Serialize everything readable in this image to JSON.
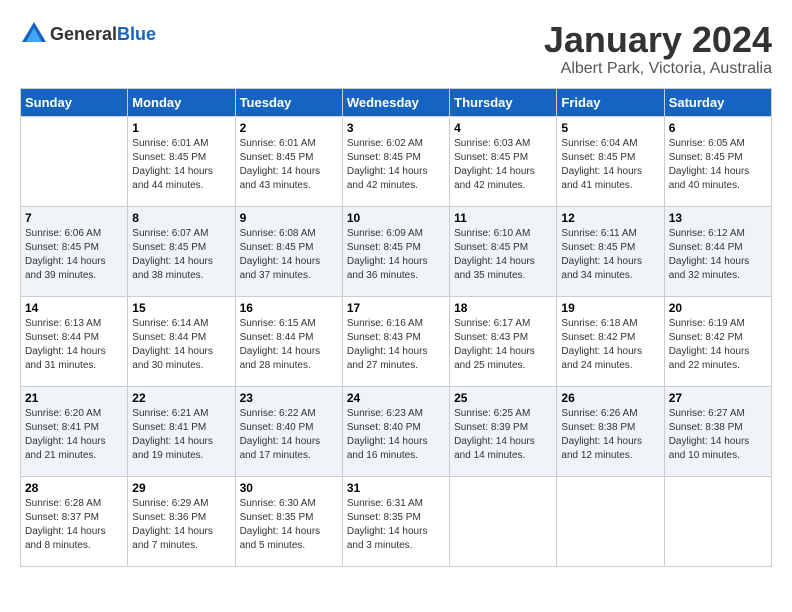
{
  "logo": {
    "text_general": "General",
    "text_blue": "Blue"
  },
  "header": {
    "month_year": "January 2024",
    "location": "Albert Park, Victoria, Australia"
  },
  "columns": [
    "Sunday",
    "Monday",
    "Tuesday",
    "Wednesday",
    "Thursday",
    "Friday",
    "Saturday"
  ],
  "rows": [
    [
      {
        "date": "",
        "sunrise": "",
        "sunset": "",
        "daylight": ""
      },
      {
        "date": "1",
        "sunrise": "Sunrise: 6:01 AM",
        "sunset": "Sunset: 8:45 PM",
        "daylight": "Daylight: 14 hours and 44 minutes."
      },
      {
        "date": "2",
        "sunrise": "Sunrise: 6:01 AM",
        "sunset": "Sunset: 8:45 PM",
        "daylight": "Daylight: 14 hours and 43 minutes."
      },
      {
        "date": "3",
        "sunrise": "Sunrise: 6:02 AM",
        "sunset": "Sunset: 8:45 PM",
        "daylight": "Daylight: 14 hours and 42 minutes."
      },
      {
        "date": "4",
        "sunrise": "Sunrise: 6:03 AM",
        "sunset": "Sunset: 8:45 PM",
        "daylight": "Daylight: 14 hours and 42 minutes."
      },
      {
        "date": "5",
        "sunrise": "Sunrise: 6:04 AM",
        "sunset": "Sunset: 8:45 PM",
        "daylight": "Daylight: 14 hours and 41 minutes."
      },
      {
        "date": "6",
        "sunrise": "Sunrise: 6:05 AM",
        "sunset": "Sunset: 8:45 PM",
        "daylight": "Daylight: 14 hours and 40 minutes."
      }
    ],
    [
      {
        "date": "7",
        "sunrise": "Sunrise: 6:06 AM",
        "sunset": "Sunset: 8:45 PM",
        "daylight": "Daylight: 14 hours and 39 minutes."
      },
      {
        "date": "8",
        "sunrise": "Sunrise: 6:07 AM",
        "sunset": "Sunset: 8:45 PM",
        "daylight": "Daylight: 14 hours and 38 minutes."
      },
      {
        "date": "9",
        "sunrise": "Sunrise: 6:08 AM",
        "sunset": "Sunset: 8:45 PM",
        "daylight": "Daylight: 14 hours and 37 minutes."
      },
      {
        "date": "10",
        "sunrise": "Sunrise: 6:09 AM",
        "sunset": "Sunset: 8:45 PM",
        "daylight": "Daylight: 14 hours and 36 minutes."
      },
      {
        "date": "11",
        "sunrise": "Sunrise: 6:10 AM",
        "sunset": "Sunset: 8:45 PM",
        "daylight": "Daylight: 14 hours and 35 minutes."
      },
      {
        "date": "12",
        "sunrise": "Sunrise: 6:11 AM",
        "sunset": "Sunset: 8:45 PM",
        "daylight": "Daylight: 14 hours and 34 minutes."
      },
      {
        "date": "13",
        "sunrise": "Sunrise: 6:12 AM",
        "sunset": "Sunset: 8:44 PM",
        "daylight": "Daylight: 14 hours and 32 minutes."
      }
    ],
    [
      {
        "date": "14",
        "sunrise": "Sunrise: 6:13 AM",
        "sunset": "Sunset: 8:44 PM",
        "daylight": "Daylight: 14 hours and 31 minutes."
      },
      {
        "date": "15",
        "sunrise": "Sunrise: 6:14 AM",
        "sunset": "Sunset: 8:44 PM",
        "daylight": "Daylight: 14 hours and 30 minutes."
      },
      {
        "date": "16",
        "sunrise": "Sunrise: 6:15 AM",
        "sunset": "Sunset: 8:44 PM",
        "daylight": "Daylight: 14 hours and 28 minutes."
      },
      {
        "date": "17",
        "sunrise": "Sunrise: 6:16 AM",
        "sunset": "Sunset: 8:43 PM",
        "daylight": "Daylight: 14 hours and 27 minutes."
      },
      {
        "date": "18",
        "sunrise": "Sunrise: 6:17 AM",
        "sunset": "Sunset: 8:43 PM",
        "daylight": "Daylight: 14 hours and 25 minutes."
      },
      {
        "date": "19",
        "sunrise": "Sunrise: 6:18 AM",
        "sunset": "Sunset: 8:42 PM",
        "daylight": "Daylight: 14 hours and 24 minutes."
      },
      {
        "date": "20",
        "sunrise": "Sunrise: 6:19 AM",
        "sunset": "Sunset: 8:42 PM",
        "daylight": "Daylight: 14 hours and 22 minutes."
      }
    ],
    [
      {
        "date": "21",
        "sunrise": "Sunrise: 6:20 AM",
        "sunset": "Sunset: 8:41 PM",
        "daylight": "Daylight: 14 hours and 21 minutes."
      },
      {
        "date": "22",
        "sunrise": "Sunrise: 6:21 AM",
        "sunset": "Sunset: 8:41 PM",
        "daylight": "Daylight: 14 hours and 19 minutes."
      },
      {
        "date": "23",
        "sunrise": "Sunrise: 6:22 AM",
        "sunset": "Sunset: 8:40 PM",
        "daylight": "Daylight: 14 hours and 17 minutes."
      },
      {
        "date": "24",
        "sunrise": "Sunrise: 6:23 AM",
        "sunset": "Sunset: 8:40 PM",
        "daylight": "Daylight: 14 hours and 16 minutes."
      },
      {
        "date": "25",
        "sunrise": "Sunrise: 6:25 AM",
        "sunset": "Sunset: 8:39 PM",
        "daylight": "Daylight: 14 hours and 14 minutes."
      },
      {
        "date": "26",
        "sunrise": "Sunrise: 6:26 AM",
        "sunset": "Sunset: 8:38 PM",
        "daylight": "Daylight: 14 hours and 12 minutes."
      },
      {
        "date": "27",
        "sunrise": "Sunrise: 6:27 AM",
        "sunset": "Sunset: 8:38 PM",
        "daylight": "Daylight: 14 hours and 10 minutes."
      }
    ],
    [
      {
        "date": "28",
        "sunrise": "Sunrise: 6:28 AM",
        "sunset": "Sunset: 8:37 PM",
        "daylight": "Daylight: 14 hours and 8 minutes."
      },
      {
        "date": "29",
        "sunrise": "Sunrise: 6:29 AM",
        "sunset": "Sunset: 8:36 PM",
        "daylight": "Daylight: 14 hours and 7 minutes."
      },
      {
        "date": "30",
        "sunrise": "Sunrise: 6:30 AM",
        "sunset": "Sunset: 8:35 PM",
        "daylight": "Daylight: 14 hours and 5 minutes."
      },
      {
        "date": "31",
        "sunrise": "Sunrise: 6:31 AM",
        "sunset": "Sunset: 8:35 PM",
        "daylight": "Daylight: 14 hours and 3 minutes."
      },
      {
        "date": "",
        "sunrise": "",
        "sunset": "",
        "daylight": ""
      },
      {
        "date": "",
        "sunrise": "",
        "sunset": "",
        "daylight": ""
      },
      {
        "date": "",
        "sunrise": "",
        "sunset": "",
        "daylight": ""
      }
    ]
  ]
}
